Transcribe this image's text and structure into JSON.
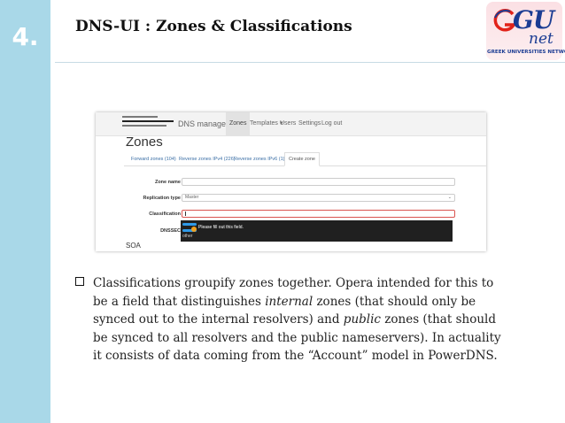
{
  "slide": {
    "number": "4.",
    "title": "DNS-UI : Zones & Classifications"
  },
  "logo": {
    "brand": "GU",
    "suffix": "net",
    "tagline": "GREEK UNIVERSITIES NETWORK",
    "colors": {
      "primary": "#1b3c93",
      "accent": "#e2231a",
      "background": "#fbe0e4"
    }
  },
  "app": {
    "nav": {
      "title": "DNS management",
      "items": [
        "Zones",
        "Templates ▾",
        "Users",
        "Settings",
        "Log out"
      ]
    },
    "page_title": "Zones",
    "tabs": [
      "Forward zones (104)",
      "Reverse zones IPv4 (226)",
      "Reverse zones IPv6 (1)",
      "Create zone"
    ],
    "active_tab": "Create zone",
    "form": {
      "zone_name_label": "Zone name",
      "zone_name_value": "",
      "replication_type_label": "Replication type",
      "replication_type_value": "Master",
      "classification_label": "Classification",
      "classification_value": "",
      "dnssec_label": "DNSSEC"
    },
    "tooltip": {
      "message": "Please fill out this field.",
      "option": "other"
    },
    "soa_heading": "SOA"
  },
  "bullet": {
    "p1": "Classifications groupify zones together. Opera intended for this to be a field that distinguishes ",
    "em1": "internal",
    "p2": " zones (that should only be synced out to the internal resolvers) and ",
    "em2": "public",
    "p3": " zones (that should be synced to all resolvers and the public nameservers). In actuality it consists of data coming from the “Account” model in PowerDNS."
  }
}
